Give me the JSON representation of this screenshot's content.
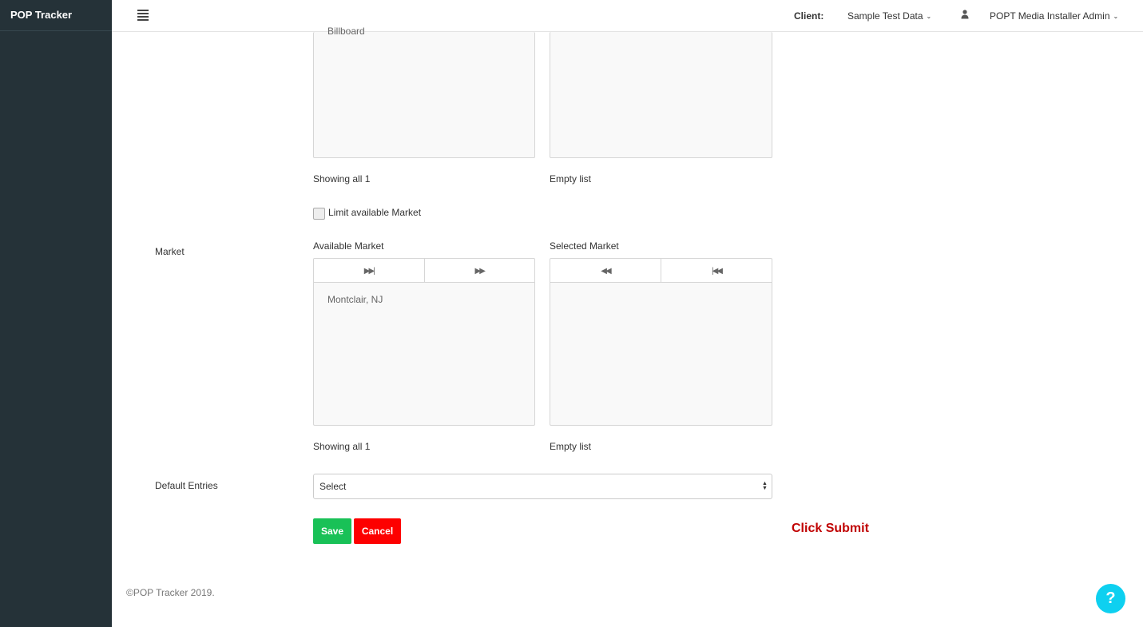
{
  "app": {
    "brand": "POP Tracker"
  },
  "topbar": {
    "client_label": "Client:",
    "client_value": "Sample Test Data",
    "user_name": "POPT Media Installer Admin",
    "icons": {
      "menu": "hamburger-icon",
      "user": "user-icon",
      "chevron": "chevron-down-icon"
    }
  },
  "media_type": {
    "available_items": [
      "Billboard"
    ],
    "available_status": "Showing all 1",
    "selected_status": "Empty list"
  },
  "market": {
    "field_label": "Market",
    "limit_label": "Limit available Market",
    "limit_checked": false,
    "available_title": "Available Market",
    "selected_title": "Selected Market",
    "available_items": [
      "Montclair, NJ"
    ],
    "available_status": "Showing all 1",
    "selected_status": "Empty list",
    "move_icons": {
      "move_all": "move-all-right-icon",
      "move_selected": "move-right-icon",
      "remove_selected": "move-left-icon",
      "remove_all": "move-all-left-icon"
    }
  },
  "default_entries": {
    "label": "Default Entries",
    "value": "Select"
  },
  "actions": {
    "save": "Save",
    "cancel": "Cancel"
  },
  "annotation": "Click Submit",
  "footer": "©POP Tracker 2019.",
  "help": "?",
  "colors": {
    "sidebar": "#253238",
    "save": "#19c157",
    "cancel": "#fd0000",
    "annotation": "#c00000",
    "help": "#0ed0f0"
  }
}
